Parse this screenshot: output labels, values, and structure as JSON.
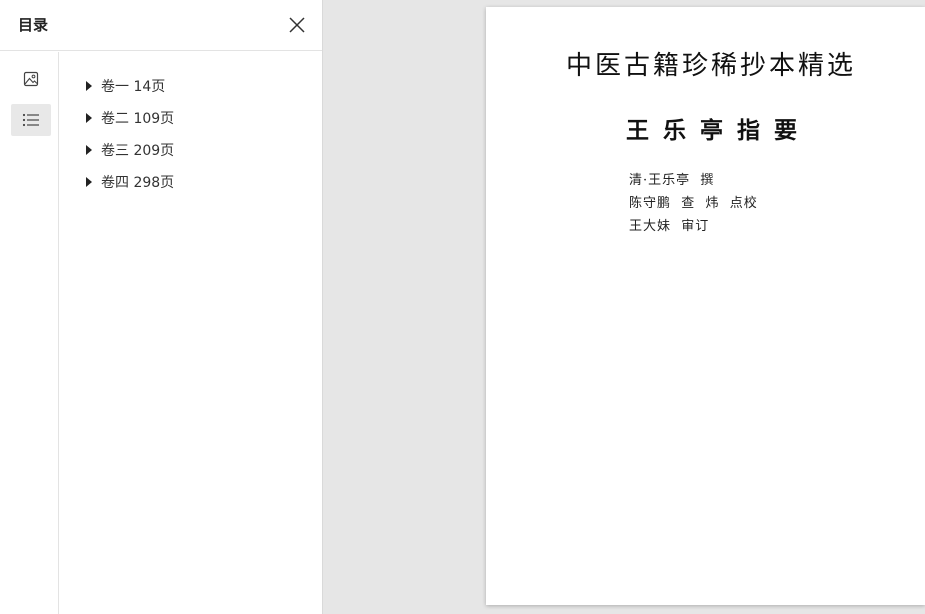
{
  "panel": {
    "title": "目录",
    "close_icon": "close-icon",
    "rail": [
      {
        "name": "thumbnails",
        "icon": "image-icon",
        "active": false
      },
      {
        "name": "outline",
        "icon": "list-icon",
        "active": true
      }
    ],
    "outline": [
      {
        "label": "卷一 14页"
      },
      {
        "label": "卷二 109页"
      },
      {
        "label": "卷三 209页"
      },
      {
        "label": "卷四 298页"
      }
    ]
  },
  "document": {
    "series_title": "中医古籍珍稀抄本精选",
    "book_title": "王乐亭指要",
    "credits": [
      "清·王乐亭  撰",
      "陈守鹏  查  炜  点校",
      "王大妹  审订"
    ]
  },
  "colors": {
    "viewer_background": "#e6e6e6",
    "panel_background": "#ffffff",
    "active_rail_background": "#e8e8e8"
  }
}
